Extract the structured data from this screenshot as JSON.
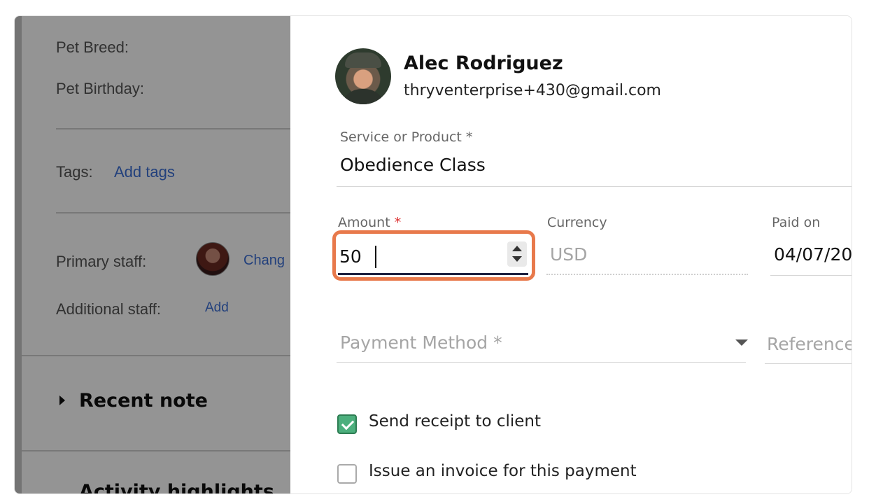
{
  "background": {
    "pet_breed_label": "Pet Breed:",
    "pet_birthday_label": "Pet Birthday:",
    "tags_label": "Tags:",
    "add_tags_link": "Add tags",
    "primary_staff_label": "Primary staff:",
    "change_link": "Chang",
    "additional_staff_label": "Additional staff:",
    "add_link": "Add",
    "recent_note_heading": "Recent note",
    "activity_heading": "Activity highlights"
  },
  "client": {
    "name": "Alec Rodriguez",
    "email": "thryventerprise+430@gmail.com"
  },
  "form": {
    "service_label": "Service or Product *",
    "service_value": "Obedience Class",
    "amount_label": "Amount",
    "amount_required": "*",
    "amount_value": "50",
    "currency_label": "Currency",
    "currency_value": "USD",
    "paid_on_label": "Paid on",
    "paid_on_value": "04/07/20",
    "payment_method_placeholder": "Payment Method *",
    "reference_placeholder": "Reference",
    "send_receipt_label": "Send receipt to client",
    "send_receipt_checked": true,
    "issue_invoice_label": "Issue an invoice for this payment",
    "issue_invoice_checked": false
  },
  "colors": {
    "highlight": "#e8794b",
    "checkbox_checked": "#4caf7d",
    "link": "#3b6fd6"
  }
}
